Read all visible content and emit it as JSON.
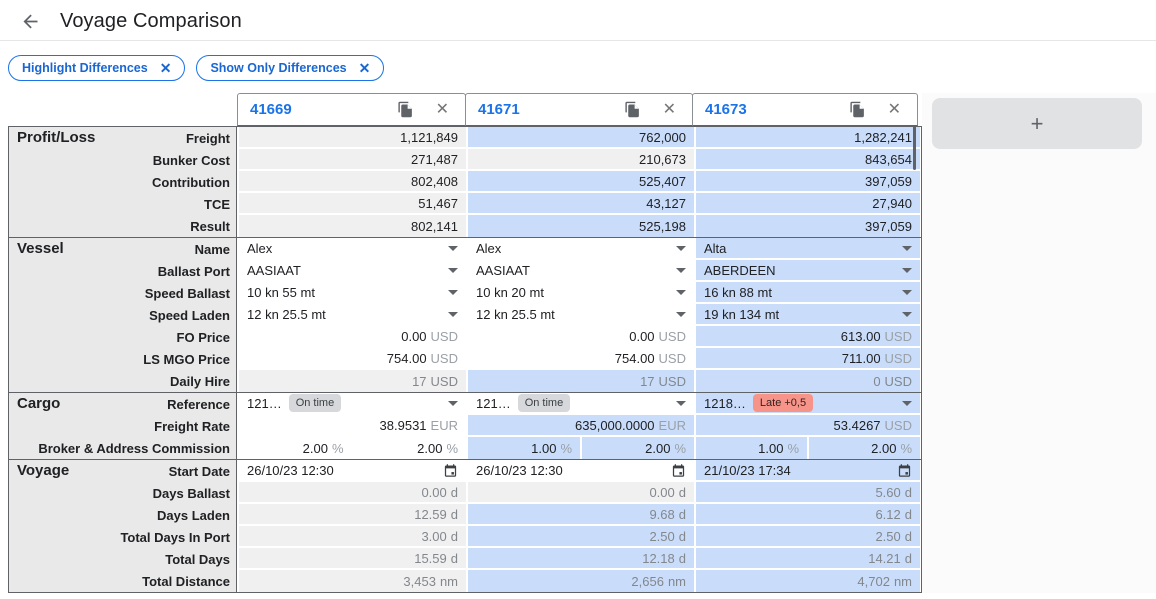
{
  "header": {
    "title": "Voyage Comparison"
  },
  "filters": [
    {
      "label": "Highlight Differences"
    },
    {
      "label": "Show Only Differences"
    }
  ],
  "add_column": {
    "label": "+"
  },
  "columns": [
    {
      "id": "41669"
    },
    {
      "id": "41671"
    },
    {
      "id": "41673"
    }
  ],
  "colors": {
    "accent": "#1a73e8",
    "highlight_bg": "#c9ddfb",
    "readonly_bg": "#f0f0f1",
    "label_column_bg": "#e9e9e9",
    "dark_border": "#5f6368",
    "muted_text": "#83878c",
    "badge_on_time_bg": "#d6d8db",
    "badge_late_bg": "#f6948a"
  },
  "groups": [
    {
      "name": "Profit/Loss",
      "rows": [
        {
          "label": "Freight",
          "cells": [
            {
              "kind": "num",
              "t": "1,121,849",
              "bg": "gray"
            },
            {
              "kind": "num",
              "t": "762,000",
              "bg": "blue"
            },
            {
              "kind": "num",
              "t": "1,282,241",
              "bg": "blue"
            }
          ]
        },
        {
          "label": "Bunker Cost",
          "cells": [
            {
              "kind": "num",
              "t": "271,487",
              "bg": "gray"
            },
            {
              "kind": "num",
              "t": "210,673",
              "bg": "gray"
            },
            {
              "kind": "num",
              "t": "843,654",
              "bg": "blue"
            }
          ]
        },
        {
          "label": "Contribution",
          "cells": [
            {
              "kind": "num",
              "t": "802,408",
              "bg": "gray"
            },
            {
              "kind": "num",
              "t": "525,407",
              "bg": "blue"
            },
            {
              "kind": "num",
              "t": "397,059",
              "bg": "blue"
            }
          ]
        },
        {
          "label": "TCE",
          "cells": [
            {
              "kind": "num",
              "t": "51,467",
              "bg": "gray"
            },
            {
              "kind": "num",
              "t": "43,127",
              "bg": "blue"
            },
            {
              "kind": "num",
              "t": "27,940",
              "bg": "blue"
            }
          ]
        },
        {
          "label": "Result",
          "cells": [
            {
              "kind": "num",
              "t": "802,141",
              "bg": "gray"
            },
            {
              "kind": "num",
              "t": "525,198",
              "bg": "blue"
            },
            {
              "kind": "num",
              "t": "397,059",
              "bg": "blue"
            }
          ]
        }
      ]
    },
    {
      "name": "Vessel",
      "rows": [
        {
          "label": "Name",
          "cells": [
            {
              "kind": "dd",
              "t": "Alex",
              "bg": "white"
            },
            {
              "kind": "dd",
              "t": "Alex",
              "bg": "white"
            },
            {
              "kind": "dd",
              "t": "Alta",
              "bg": "blue"
            }
          ]
        },
        {
          "label": "Ballast Port",
          "cells": [
            {
              "kind": "dd",
              "t": "AASIAAT",
              "bg": "white"
            },
            {
              "kind": "dd",
              "t": "AASIAAT",
              "bg": "white"
            },
            {
              "kind": "dd",
              "t": "ABERDEEN",
              "bg": "blue"
            }
          ]
        },
        {
          "label": "Speed Ballast",
          "cells": [
            {
              "kind": "dd",
              "t": "10 kn 55 mt",
              "bg": "white"
            },
            {
              "kind": "dd",
              "t": "10 kn 20 mt",
              "bg": "white"
            },
            {
              "kind": "dd",
              "t": "16 kn 88 mt",
              "bg": "blue"
            }
          ]
        },
        {
          "label": "Speed Laden",
          "cells": [
            {
              "kind": "dd",
              "t": "12 kn 25.5 mt",
              "bg": "white"
            },
            {
              "kind": "dd",
              "t": "12 kn 25.5 mt",
              "bg": "white"
            },
            {
              "kind": "dd",
              "t": "19 kn 134 mt",
              "bg": "blue"
            }
          ]
        },
        {
          "label": "FO Price",
          "cells": [
            {
              "kind": "num",
              "t": "0.00",
              "u": "USD",
              "bg": "white"
            },
            {
              "kind": "num",
              "t": "0.00",
              "u": "USD",
              "bg": "white"
            },
            {
              "kind": "num",
              "t": "613.00",
              "u": "USD",
              "bg": "blue"
            }
          ]
        },
        {
          "label": "LS MGO Price",
          "cells": [
            {
              "kind": "num",
              "t": "754.00",
              "u": "USD",
              "bg": "white"
            },
            {
              "kind": "num",
              "t": "754.00",
              "u": "USD",
              "bg": "white"
            },
            {
              "kind": "num",
              "t": "711.00",
              "u": "USD",
              "bg": "blue"
            }
          ]
        },
        {
          "label": "Daily Hire",
          "cells": [
            {
              "kind": "num",
              "t": "17",
              "u": "USD",
              "bg": "gray",
              "muted": true
            },
            {
              "kind": "num",
              "t": "17",
              "u": "USD",
              "bg": "blue",
              "muted": true
            },
            {
              "kind": "num",
              "t": "0",
              "u": "USD",
              "bg": "blue",
              "muted": true
            }
          ]
        }
      ]
    },
    {
      "name": "Cargo",
      "rows": [
        {
          "label": "Reference",
          "cells": [
            {
              "kind": "ref",
              "t": "121…",
              "badge": "On time",
              "badge_type": "ontime",
              "bg": "white"
            },
            {
              "kind": "ref",
              "t": "121…",
              "badge": "On time",
              "badge_type": "ontime",
              "bg": "white"
            },
            {
              "kind": "ref",
              "t": "1218…",
              "badge": "Late +0,5",
              "badge_type": "late",
              "bg": "blue"
            }
          ]
        },
        {
          "label": "Freight Rate",
          "cells": [
            {
              "kind": "num",
              "t": "38.9531",
              "u": "EUR",
              "bg": "white"
            },
            {
              "kind": "num",
              "t": "635,000.0000",
              "u": "EUR",
              "bg": "blue"
            },
            {
              "kind": "num",
              "t": "53.4267",
              "u": "USD",
              "bg": "blue"
            }
          ]
        },
        {
          "label": "Broker & Address Commission",
          "cells": [
            {
              "kind": "split",
              "v1": "2.00",
              "u1": "%",
              "v2": "2.00",
              "u2": "%",
              "bg": "white"
            },
            {
              "kind": "split",
              "v1": "1.00",
              "u1": "%",
              "v2": "2.00",
              "u2": "%",
              "bg": "blue"
            },
            {
              "kind": "split",
              "v1": "1.00",
              "u1": "%",
              "v2": "2.00",
              "u2": "%",
              "bg": "blue"
            }
          ]
        }
      ]
    },
    {
      "name": "Voyage",
      "rows": [
        {
          "label": "Start Date",
          "cells": [
            {
              "kind": "date",
              "t": "26/10/23 12:30",
              "bg": "white"
            },
            {
              "kind": "date",
              "t": "26/10/23 12:30",
              "bg": "white"
            },
            {
              "kind": "date",
              "t": "21/10/23 17:34",
              "bg": "blue"
            }
          ]
        },
        {
          "label": "Days Ballast",
          "cells": [
            {
              "kind": "num",
              "t": "0.00",
              "u": "d",
              "bg": "gray",
              "muted": true
            },
            {
              "kind": "num",
              "t": "0.00",
              "u": "d",
              "bg": "gray",
              "muted": true
            },
            {
              "kind": "num",
              "t": "5.60",
              "u": "d",
              "bg": "blue",
              "muted": true
            }
          ]
        },
        {
          "label": "Days Laden",
          "cells": [
            {
              "kind": "num",
              "t": "12.59",
              "u": "d",
              "bg": "gray",
              "muted": true
            },
            {
              "kind": "num",
              "t": "9.68",
              "u": "d",
              "bg": "blue",
              "muted": true
            },
            {
              "kind": "num",
              "t": "6.12",
              "u": "d",
              "bg": "blue",
              "muted": true
            }
          ]
        },
        {
          "label": "Total Days In Port",
          "cells": [
            {
              "kind": "num",
              "t": "3.00",
              "u": "d",
              "bg": "gray",
              "muted": true
            },
            {
              "kind": "num",
              "t": "2.50",
              "u": "d",
              "bg": "blue",
              "muted": true
            },
            {
              "kind": "num",
              "t": "2.50",
              "u": "d",
              "bg": "blue",
              "muted": true
            }
          ]
        },
        {
          "label": "Total Days",
          "cells": [
            {
              "kind": "num",
              "t": "15.59",
              "u": "d",
              "bg": "gray",
              "muted": true
            },
            {
              "kind": "num",
              "t": "12.18",
              "u": "d",
              "bg": "blue",
              "muted": true
            },
            {
              "kind": "num",
              "t": "14.21",
              "u": "d",
              "bg": "blue",
              "muted": true
            }
          ]
        },
        {
          "label": "Total Distance",
          "cells": [
            {
              "kind": "num",
              "t": "3,453",
              "u": "nm",
              "bg": "gray",
              "muted": true
            },
            {
              "kind": "num",
              "t": "2,656",
              "u": "nm",
              "bg": "blue",
              "muted": true
            },
            {
              "kind": "num",
              "t": "4,702",
              "u": "nm",
              "bg": "blue",
              "muted": true
            }
          ]
        }
      ]
    }
  ]
}
